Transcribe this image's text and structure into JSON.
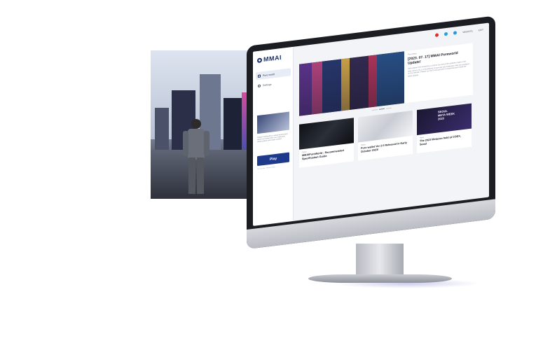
{
  "colors": {
    "brand": "#1d2f63",
    "play_button": "#1f3a8a",
    "screen_bg": "#f3f4f7"
  },
  "app": {
    "logo_text": "MMAI"
  },
  "top_nav": {
    "social_icons": [
      "youtube-icon",
      "telegram-icon",
      "twitter-icon"
    ],
    "links": [
      "WEBSITE",
      "EDIT"
    ]
  },
  "sidebar": {
    "items": [
      {
        "label": "Pure world",
        "icon": "pen-icon",
        "active": true
      },
      {
        "label": "Settings",
        "icon": "gear-icon",
        "active": false
      }
    ],
    "promo_text": "Global PureWorld is a virtual world where users can create their own metaverse using avatars and create content",
    "play_label": "Play",
    "legal_text": "Terms of use · Privacy Policy"
  },
  "feature": {
    "tag": "Pure News",
    "title": "[2023. 07. 17] MMAI Pureworld Update!",
    "body": "Dear players We would like to inform you about the updates made to the beta version V2.1 of PureWorld. Download and installation files are available on the website. Please run the PureLauncher to download and install the latest update."
  },
  "news_cards": [
    {
      "tag": "Notice",
      "title": "MMAIPureWorld : Recommended Specification Guide"
    },
    {
      "tag": "Notice",
      "title": "Pure wallet Ver 2.0 Released in Early October 2023!"
    },
    {
      "tag": "News",
      "title": "The 2023 Metacon held at COEX, Seoul"
    }
  ],
  "seoul_banner": {
    "line1": "SEOUL",
    "line2": "META WEEK",
    "line3": "2023"
  }
}
